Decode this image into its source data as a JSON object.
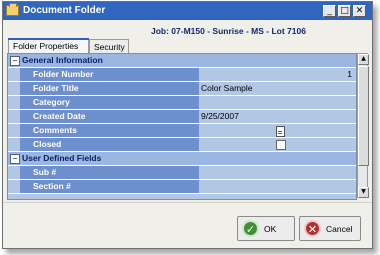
{
  "window": {
    "title": "Document Folder",
    "controls": {
      "minimize": "_",
      "maximize": "□",
      "close": "✕"
    }
  },
  "job": {
    "text": "Job:  07-M150 - Sunrise - MS - Lot 7106"
  },
  "tabs": [
    {
      "label": "Folder Properties",
      "active": true
    },
    {
      "label": "Security",
      "active": false
    }
  ],
  "sections": {
    "general": {
      "label": "General Information",
      "toggle": "−",
      "rows": [
        {
          "label": "Folder Number",
          "value": "1"
        },
        {
          "label": "Folder Title",
          "value": "Color Sample"
        },
        {
          "label": "Category",
          "value": ""
        },
        {
          "label": "Created Date",
          "value": "9/25/2007"
        },
        {
          "label": "Comments",
          "value": ""
        },
        {
          "label": "Closed",
          "value": ""
        }
      ]
    },
    "user": {
      "label": "User Defined Fields",
      "toggle": "−",
      "rows": [
        {
          "label": "Sub #",
          "value": ""
        },
        {
          "label": "Section #",
          "value": ""
        }
      ]
    }
  },
  "scrollbar": {
    "up": "▲",
    "down": "▼"
  },
  "buttons": {
    "ok": {
      "label": "OK",
      "icon": "✓"
    },
    "cancel": {
      "label": "Cancel",
      "icon": "✕"
    }
  },
  "colors": {
    "titlebar": "#3066c0",
    "label_cell": "#6e8fce",
    "grid_bg": "#b2c7e4",
    "section_bg": "#9bb6e0"
  }
}
